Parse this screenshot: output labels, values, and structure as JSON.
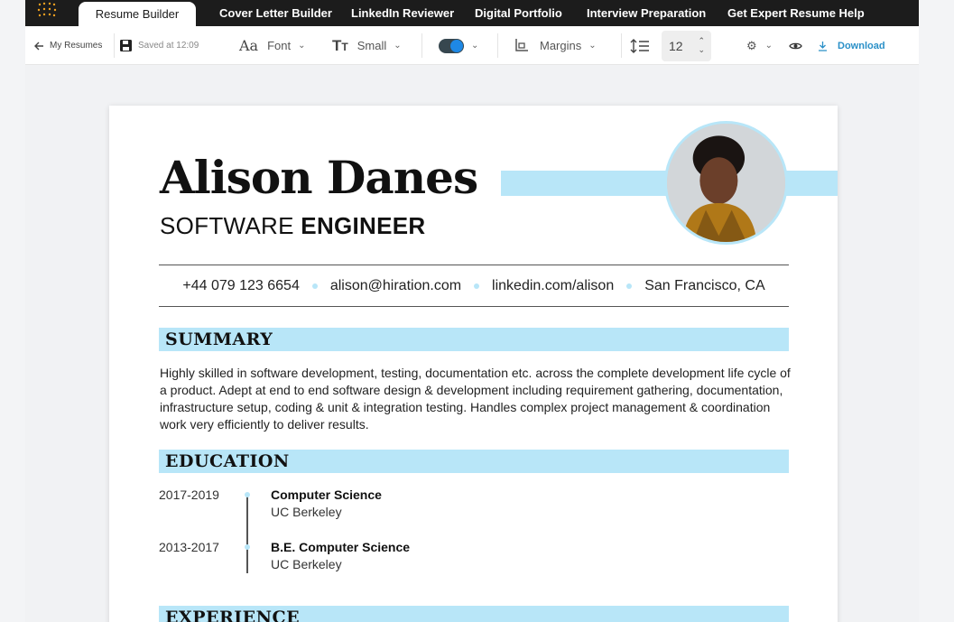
{
  "topnav": {
    "tabs": [
      {
        "label": "Resume Builder"
      },
      {
        "label": "Cover Letter Builder"
      },
      {
        "label": "LinkedIn Reviewer"
      },
      {
        "label": "Digital Portfolio"
      },
      {
        "label": "Interview Preparation"
      },
      {
        "label": "Get Expert Resume Help"
      }
    ]
  },
  "toolbar": {
    "back_label": "My Resumes",
    "saved_label": "Saved at 12:09",
    "font_label": "Font",
    "size_label": "Small",
    "margins_label": "Margins",
    "line_spacing_value": "12",
    "download_label": "Download"
  },
  "resume": {
    "name": "Alison Danes",
    "role_light": "SOFTWARE",
    "role_bold": "ENGINEER",
    "contact": {
      "phone": "+44 079 123 6654",
      "email": "alison@hiration.com",
      "linkedin": "linkedin.com/alison",
      "location": "San Francisco, CA"
    },
    "summary_heading": "SUMMARY",
    "summary_text": "Highly skilled in software development, testing, documentation etc. across the complete development life cycle of a product. Adept at end to end software design & development including requirement gathering, documentation, infrastructure setup, coding & unit & integration testing. Handles complex project management & coordination work very efficiently to deliver results.",
    "education_heading": "EDUCATION",
    "education": [
      {
        "dates": "2017-2019",
        "degree": "Computer Science",
        "school": "UC Berkeley"
      },
      {
        "dates": "2013-2017",
        "degree": "B.E. Computer Science",
        "school": "UC Berkeley"
      }
    ],
    "experience_heading": "EXPERIENCE"
  },
  "colors": {
    "accent": "#b8e6f8",
    "nav_bg": "#1c1c1c",
    "download": "#2a90c8",
    "toggle_blue": "#1e88e5"
  }
}
